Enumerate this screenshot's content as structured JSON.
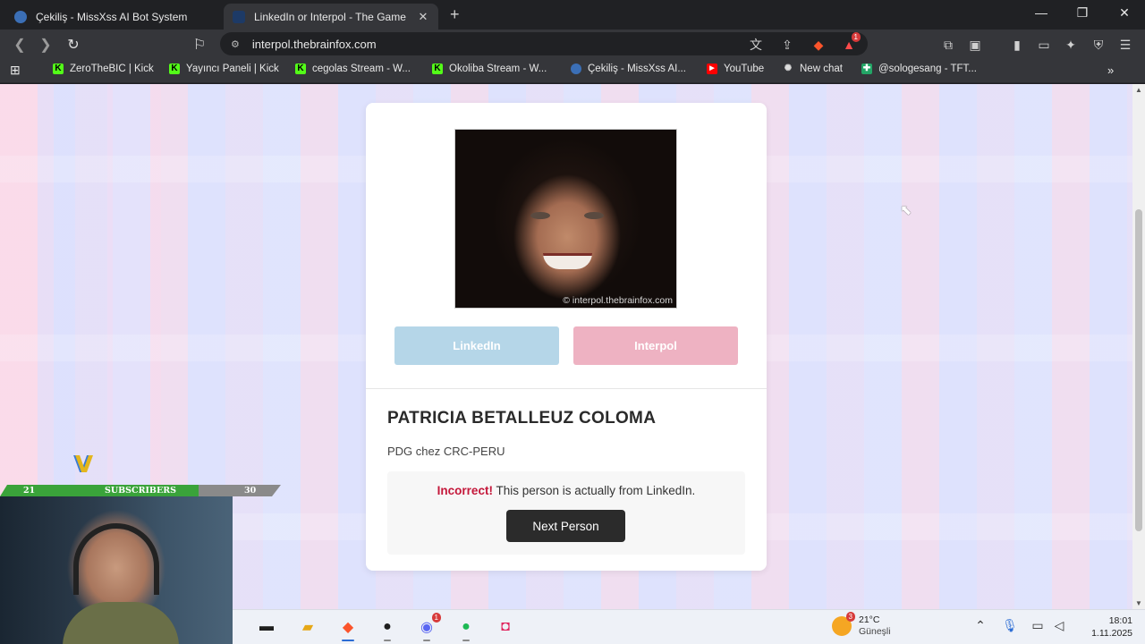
{
  "browser": {
    "tabs": [
      {
        "title": "Çekiliş - MissXss AI Bot System",
        "active": false
      },
      {
        "title": "LinkedIn or Interpol - The Game",
        "active": true
      }
    ],
    "new_tab_icon": "plus-icon",
    "url": "interpol.thebrainfox.com",
    "shields_badge": "",
    "rewards_badge": "1",
    "bookmarks": [
      {
        "label": "ZeroTheBIC | Kick",
        "icon": "kick-icon"
      },
      {
        "label": "Yayıncı Paneli | Kick",
        "icon": "kick-icon"
      },
      {
        "label": "cegolas Stream - W...",
        "icon": "kick-icon"
      },
      {
        "label": "Okoliba Stream - W...",
        "icon": "kick-icon"
      },
      {
        "label": "Çekiliş - MissXss AI...",
        "icon": "globe-icon"
      },
      {
        "label": "YouTube",
        "icon": "youtube-icon"
      },
      {
        "label": "New chat",
        "icon": "openai-icon"
      },
      {
        "label": "@sologesang - TFT...",
        "icon": "sheets-icon"
      }
    ]
  },
  "game": {
    "photo_watermark": "© interpol.thebrainfox.com",
    "linkedin_label": "LinkedIn",
    "interpol_label": "Interpol",
    "person_name": "PATRICIA BETALLEUZ COLOMA",
    "person_role": "PDG chez CRC-PERU",
    "result_prefix": "Incorrect!",
    "result_text": " This person is actually from LinkedIn.",
    "next_label": "Next Person"
  },
  "stream_overlay": {
    "subs_current": "21",
    "subs_label": "SUBSCRIBERS",
    "subs_goal": "30"
  },
  "taskbar": {
    "weather_badge": "3",
    "temperature": "21°C",
    "weather_desc": "Güneşli",
    "discord_badge": "1",
    "time": "18:01",
    "date": "1.11.2025"
  },
  "colors": {
    "linkedin_button": "#b5d6e8",
    "interpol_button": "#eeb2c2",
    "incorrect_text": "#c4173a",
    "next_button": "#2b2b2b"
  }
}
